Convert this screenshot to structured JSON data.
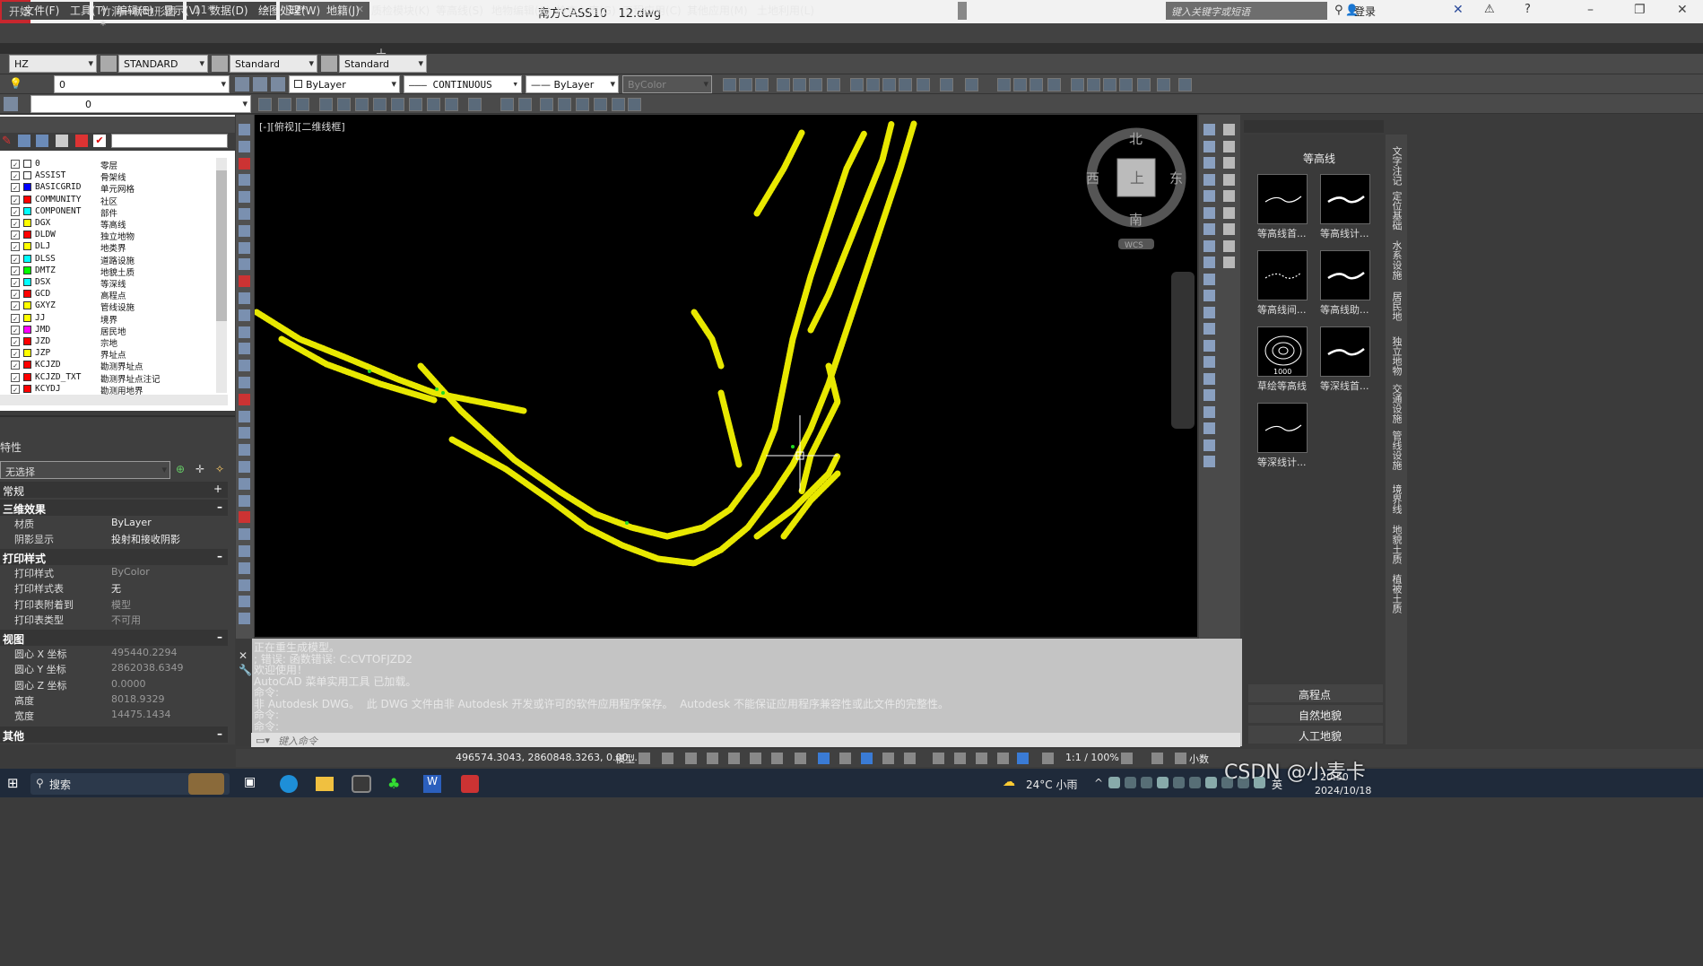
{
  "window": {
    "app_title": "南方CASS10",
    "file": "12.dwg",
    "search_placeholder": "键入关键字或短语",
    "login": "登录"
  },
  "menus": [
    "文件(F)",
    "工具(T)",
    "编辑(E)",
    "显示(V)",
    "数据(D)",
    "绘图处理(W)",
    "地籍(J)",
    "质检模块(K)",
    "等高线(S)",
    "地物编辑(A)",
    "检查入库(G)",
    "工程应用(C)",
    "其他应用(M)",
    "土地利用(L)"
  ],
  "doc_tabs": [
    {
      "label": "开始"
    },
    {
      "label": "竹洞一桥地形图*"
    },
    {
      "label": "11*"
    },
    {
      "label": "12*"
    }
  ],
  "toolbar1": {
    "layer_combo": "HZ",
    "text_style": "STANDARD",
    "dim_style": "Standard",
    "table_style": "Standard"
  },
  "toolbar2": {
    "layer_state": "0",
    "color": "ByLayer",
    "linetype": "CONTINUOUS",
    "lineweight": "ByLayer",
    "plotstyle": "ByColor"
  },
  "toolbar3": {
    "layer_state": "0"
  },
  "layers": [
    {
      "name": "0",
      "desc": "零层",
      "color": "#ffffff"
    },
    {
      "name": "ASSIST",
      "desc": "骨架线",
      "color": "#ffffff"
    },
    {
      "name": "BASICGRID",
      "desc": "单元网格",
      "color": "#0000ff"
    },
    {
      "name": "COMMUNITY",
      "desc": "社区",
      "color": "#ff0000"
    },
    {
      "name": "COMPONENT",
      "desc": "部件",
      "color": "#00ffff"
    },
    {
      "name": "DGX",
      "desc": "等高线",
      "color": "#ffff00"
    },
    {
      "name": "DLDW",
      "desc": "独立地物",
      "color": "#ff0000"
    },
    {
      "name": "DLJ",
      "desc": "地类界",
      "color": "#ffff00"
    },
    {
      "name": "DLSS",
      "desc": "道路设施",
      "color": "#00ffff"
    },
    {
      "name": "DMTZ",
      "desc": "地貌土质",
      "color": "#00ff00"
    },
    {
      "name": "DSX",
      "desc": "等深线",
      "color": "#00ffff"
    },
    {
      "name": "GCD",
      "desc": "高程点",
      "color": "#ff0000"
    },
    {
      "name": "GXYZ",
      "desc": "管线设施",
      "color": "#ffff00"
    },
    {
      "name": "JJ",
      "desc": "境界",
      "color": "#ffff00"
    },
    {
      "name": "JMD",
      "desc": "居民地",
      "color": "#ff00ff"
    },
    {
      "name": "JZD",
      "desc": "宗地",
      "color": "#ff0000"
    },
    {
      "name": "JZP",
      "desc": "界址点",
      "color": "#ffff00"
    },
    {
      "name": "KCJZD",
      "desc": "勘测界址点",
      "color": "#ff0000"
    },
    {
      "name": "KCJZD_TXT",
      "desc": "勘测界址点注记",
      "color": "#ff0000"
    },
    {
      "name": "KCYDJ",
      "desc": "勘测用地界",
      "color": "#ff0000"
    }
  ],
  "panel_tabs": {
    "layers": "图层",
    "props": "属性"
  },
  "props": {
    "header": "特性",
    "selection": "无选择",
    "sections": {
      "general": "常规",
      "effects": "三维效果",
      "print": "打印样式",
      "view": "视图",
      "other": "其他"
    },
    "effects_rows": [
      {
        "k": "材质",
        "v": "ByLayer"
      },
      {
        "k": "阴影显示",
        "v": "投射和接收阴影"
      }
    ],
    "print_rows": [
      {
        "k": "打印样式",
        "v": "ByColor"
      },
      {
        "k": "打印样式表",
        "v": "无"
      },
      {
        "k": "打印表附着到",
        "v": "模型"
      },
      {
        "k": "打印表类型",
        "v": "不可用"
      }
    ],
    "view_rows": [
      {
        "k": "圆心 X 坐标",
        "v": "495440.2294"
      },
      {
        "k": "圆心 Y 坐标",
        "v": "2862038.6349"
      },
      {
        "k": "圆心 Z 坐标",
        "v": "0.0000"
      },
      {
        "k": "高度",
        "v": "8018.9329"
      },
      {
        "k": "宽度",
        "v": "14475.1434"
      }
    ]
  },
  "viewport": {
    "label": "[-][俯视][二维线框]",
    "compass": {
      "n": "北",
      "s": "南",
      "e": "东",
      "w": "西",
      "center": "上",
      "wcs": "WCS"
    }
  },
  "command_lines": [
    "正在重生成模型。",
    "; 错误: 函数错误: C:CVTOFJZD2",
    "欢迎使用！",
    "AutoCAD 菜单实用工具 已加载。",
    "命令:",
    "非 Autodesk DWG。  此 DWG 文件由非 Autodesk 开发或许可的软件应用程序保存。  Autodesk 不能保证应用程序兼容性或此文件的完整性。",
    "命令:",
    "命令:"
  ],
  "command_prompt": "键入命令",
  "palette": {
    "title": "等高线",
    "items": [
      {
        "label": "等高线首..."
      },
      {
        "label": "等高线计..."
      },
      {
        "label": "等高线间..."
      },
      {
        "label": "等高线助..."
      },
      {
        "label": "草绘等高线"
      },
      {
        "label": "等深线首..."
      },
      {
        "label": "等深线计..."
      }
    ],
    "footer": [
      "高程点",
      "自然地貌",
      "人工地貌"
    ],
    "sketch_number": "1000"
  },
  "vertical_tabs": [
    "文字注记",
    "定位基础",
    "水系设施",
    "居民地",
    "独立地物",
    "交通设施",
    "管线设施",
    "境界线",
    "地貌土质",
    "植被土质"
  ],
  "status": {
    "coords": "496574.3043, 2860848.3263, 0.00...",
    "model": "模型",
    "scale": "1:1 / 100%",
    "decimal": "小数"
  },
  "taskbar": {
    "search": "搜索",
    "weather": "24°C 小雨",
    "ime": "英",
    "date": "2024/10/18",
    "time": "20:50",
    "watermark": "CSDN @小麦卡"
  }
}
